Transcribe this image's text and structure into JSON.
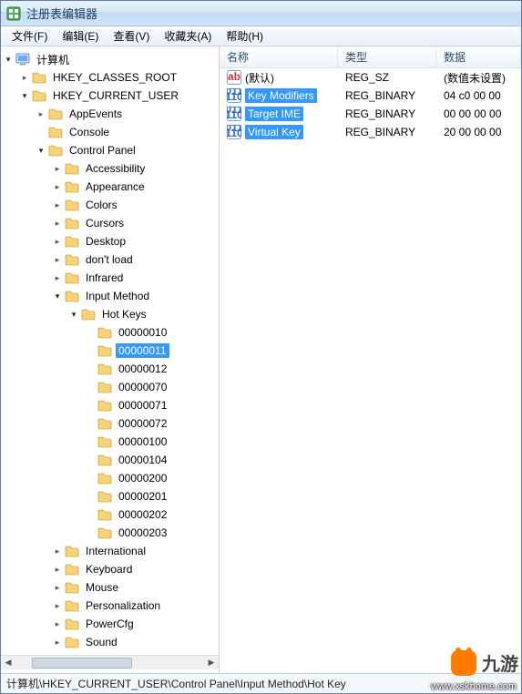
{
  "title": "注册表编辑器",
  "menu": [
    "文件(F)",
    "编辑(E)",
    "查看(V)",
    "收藏夹(A)",
    "帮助(H)"
  ],
  "tree": [
    {
      "d": 0,
      "t": "open",
      "icon": "computer",
      "label": "计算机"
    },
    {
      "d": 1,
      "t": "closed",
      "icon": "folder",
      "label": "HKEY_CLASSES_ROOT"
    },
    {
      "d": 1,
      "t": "open",
      "icon": "folder",
      "label": "HKEY_CURRENT_USER"
    },
    {
      "d": 2,
      "t": "closed",
      "icon": "folder",
      "label": "AppEvents"
    },
    {
      "d": 2,
      "t": "leaf",
      "icon": "folder",
      "label": "Console"
    },
    {
      "d": 2,
      "t": "open",
      "icon": "folder",
      "label": "Control Panel"
    },
    {
      "d": 3,
      "t": "closed",
      "icon": "folder",
      "label": "Accessibility"
    },
    {
      "d": 3,
      "t": "closed",
      "icon": "folder",
      "label": "Appearance"
    },
    {
      "d": 3,
      "t": "closed",
      "icon": "folder",
      "label": "Colors"
    },
    {
      "d": 3,
      "t": "closed",
      "icon": "folder",
      "label": "Cursors"
    },
    {
      "d": 3,
      "t": "closed",
      "icon": "folder",
      "label": "Desktop"
    },
    {
      "d": 3,
      "t": "closed",
      "icon": "folder",
      "label": "don't load"
    },
    {
      "d": 3,
      "t": "closed",
      "icon": "folder",
      "label": "Infrared"
    },
    {
      "d": 3,
      "t": "open",
      "icon": "folder",
      "label": "Input Method"
    },
    {
      "d": 4,
      "t": "open",
      "icon": "folder",
      "label": "Hot Keys"
    },
    {
      "d": 5,
      "t": "leaf",
      "icon": "folder",
      "label": "00000010"
    },
    {
      "d": 5,
      "t": "leaf",
      "icon": "folder",
      "label": "00000011",
      "sel": true
    },
    {
      "d": 5,
      "t": "leaf",
      "icon": "folder",
      "label": "00000012"
    },
    {
      "d": 5,
      "t": "leaf",
      "icon": "folder",
      "label": "00000070"
    },
    {
      "d": 5,
      "t": "leaf",
      "icon": "folder",
      "label": "00000071"
    },
    {
      "d": 5,
      "t": "leaf",
      "icon": "folder",
      "label": "00000072"
    },
    {
      "d": 5,
      "t": "leaf",
      "icon": "folder",
      "label": "00000100"
    },
    {
      "d": 5,
      "t": "leaf",
      "icon": "folder",
      "label": "00000104"
    },
    {
      "d": 5,
      "t": "leaf",
      "icon": "folder",
      "label": "00000200"
    },
    {
      "d": 5,
      "t": "leaf",
      "icon": "folder",
      "label": "00000201"
    },
    {
      "d": 5,
      "t": "leaf",
      "icon": "folder",
      "label": "00000202"
    },
    {
      "d": 5,
      "t": "leaf",
      "icon": "folder",
      "label": "00000203"
    },
    {
      "d": 3,
      "t": "closed",
      "icon": "folder",
      "label": "International"
    },
    {
      "d": 3,
      "t": "closed",
      "icon": "folder",
      "label": "Keyboard"
    },
    {
      "d": 3,
      "t": "closed",
      "icon": "folder",
      "label": "Mouse"
    },
    {
      "d": 3,
      "t": "closed",
      "icon": "folder",
      "label": "Personalization"
    },
    {
      "d": 3,
      "t": "closed",
      "icon": "folder",
      "label": "PowerCfg"
    },
    {
      "d": 3,
      "t": "closed",
      "icon": "folder",
      "label": "Sound"
    }
  ],
  "columns": {
    "name": "名称",
    "type": "类型",
    "data": "数据"
  },
  "values": [
    {
      "icon": "sz",
      "name": "(默认)",
      "type": "REG_SZ",
      "data": "(数值未设置)",
      "sel": false
    },
    {
      "icon": "bin",
      "name": "Key Modifiers",
      "type": "REG_BINARY",
      "data": "04 c0 00 00",
      "sel": true
    },
    {
      "icon": "bin",
      "name": "Target IME",
      "type": "REG_BINARY",
      "data": "00 00 00 00",
      "sel": true
    },
    {
      "icon": "bin",
      "name": "Virtual Key",
      "type": "REG_BINARY",
      "data": "20 00 00 00",
      "sel": true
    }
  ],
  "status": "计算机\\HKEY_CURRENT_USER\\Control Panel\\Input Method\\Hot Key",
  "watermark": {
    "brand": "九游",
    "url": "www.xskhome.com"
  }
}
